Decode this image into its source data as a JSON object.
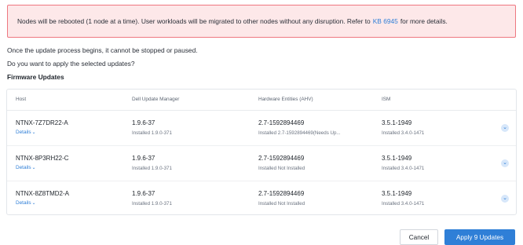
{
  "alert": {
    "text_before": "Nodes will be rebooted (1 node at a time). User workloads will be migrated to other nodes without any disruption. Refer to",
    "link": "KB 6945",
    "text_after": "for more details."
  },
  "info": {
    "line1": "Once the update process begins, it cannot be stopped or paused.",
    "line2": "Do you want to apply the selected updates?"
  },
  "section_title": "Firmware Updates",
  "table": {
    "headers": [
      "Host",
      "Dell Update Manager",
      "Hardware Entities (AHV)",
      "ISM"
    ],
    "details_label": "Details",
    "rows": [
      {
        "host": "NTNX-7Z7DR22-A",
        "dum": "1.9.6-37",
        "dum_installed": "Installed 1.9.0-371",
        "hw": "2.7-1592894469",
        "hw_installed": "Installed 2.7-1592894469(Needs Up...",
        "ism": "3.5.1-1949",
        "ism_installed": "Installed 3.4.0-1471"
      },
      {
        "host": "NTNX-8P3RH22-C",
        "dum": "1.9.6-37",
        "dum_installed": "Installed 1.9.0-371",
        "hw": "2.7-1592894469",
        "hw_installed": "Installed Not Installed",
        "ism": "3.5.1-1949",
        "ism_installed": "Installed 3.4.0-1471"
      },
      {
        "host": "NTNX-8Z8TMD2-A",
        "dum": "1.9.6-37",
        "dum_installed": "Installed 1.9.0-371",
        "hw": "2.7-1592894469",
        "hw_installed": "Installed Not Installed",
        "ism": "3.5.1-1949",
        "ism_installed": "Installed 3.4.0-1471"
      }
    ]
  },
  "buttons": {
    "cancel": "Cancel",
    "apply": "Apply 9 Updates"
  },
  "colors": {
    "accent": "#2f7fd7",
    "alert_bg": "#fde8e9",
    "alert_border": "#ee7780"
  }
}
